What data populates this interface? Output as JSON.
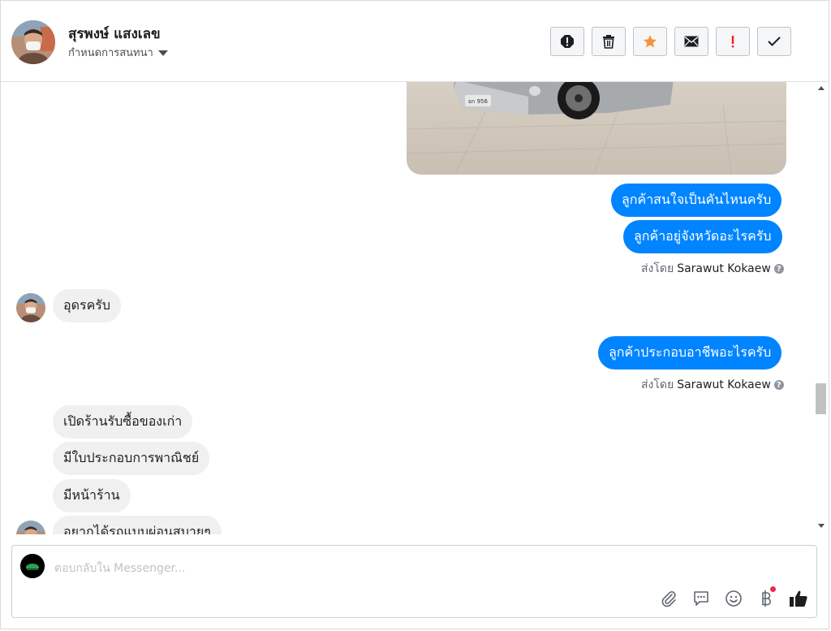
{
  "header": {
    "contact_name": "สุรพงษ์ แสงเลข",
    "conversation_setting": "กำหนดการสนทนา",
    "toolbar": [
      {
        "name": "report-spam-button",
        "icon": "alert-circle-icon"
      },
      {
        "name": "delete-button",
        "icon": "trash-icon"
      },
      {
        "name": "star-button",
        "icon": "star-icon",
        "color": "#f7923b"
      },
      {
        "name": "mark-unread-button",
        "icon": "envelope-icon"
      },
      {
        "name": "important-button",
        "icon": "exclamation-icon",
        "color": "#e9202e"
      },
      {
        "name": "mark-done-button",
        "icon": "check-icon"
      }
    ]
  },
  "conversation": {
    "outgoing": [
      "ลูกค้าสนใจเป็นคันไหนครับ",
      "ลูกค้าอยู่จังหวัดอะไรครับ",
      "ลูกค้าประกอบอาชีพอะไรครับ"
    ],
    "incoming": [
      "อุดรครับ",
      "เปิดร้านรับซื้อของเก่า",
      "มีใบประกอบการพาณิชย์",
      "มีหน้าร้าน",
      "อยากได้รถแบบผ่อนสบายๆ"
    ],
    "sent_by_prefix": "ส่งโดย",
    "sent_by_name": "Sarawut Kokaew",
    "help_glyph": "?"
  },
  "composer": {
    "placeholder": "ตอบกลับใน Messenger...",
    "icons": [
      "paperclip-icon",
      "saved-reply-icon",
      "emoji-icon",
      "baht-payment-icon",
      "like-icon"
    ],
    "notification_dot_color": "#f02849"
  },
  "colors": {
    "outgoing_bubble": "#0084ff",
    "incoming_bubble": "#f1f0f0",
    "border": "#dddfe2"
  }
}
